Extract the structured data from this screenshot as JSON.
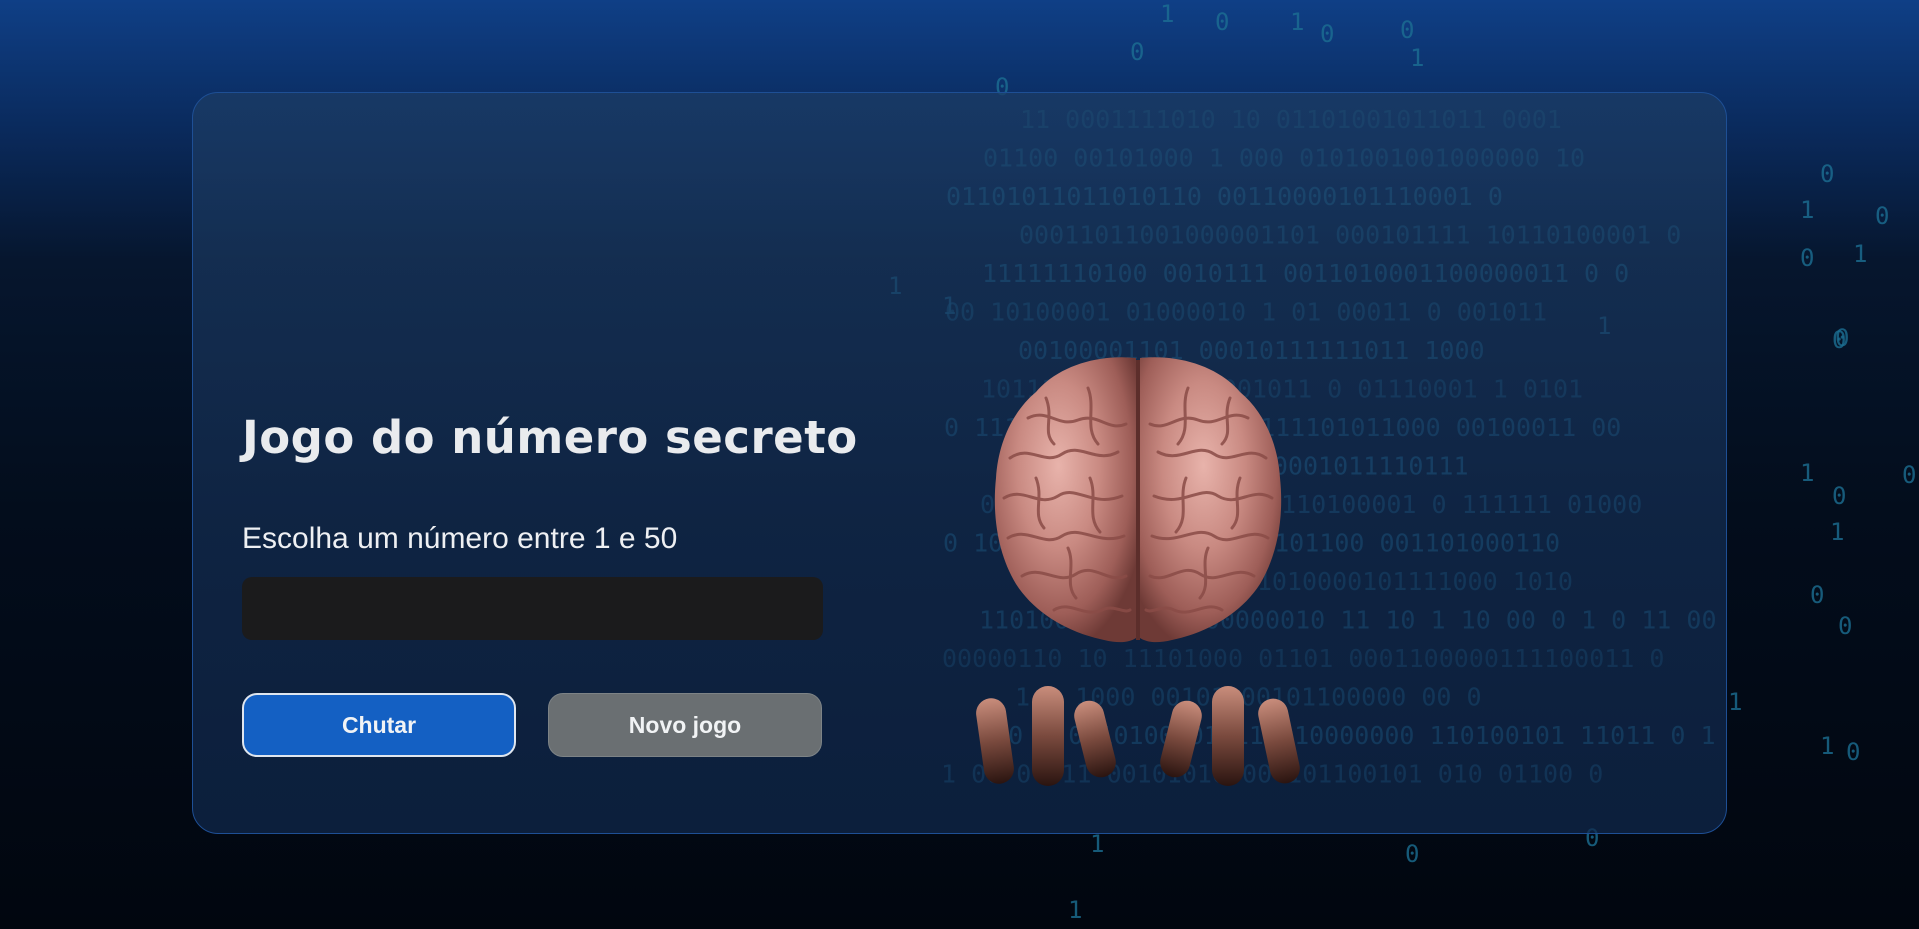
{
  "page": {
    "title": "Jogo do número secreto",
    "prompt": "Escolha um número entre 1 e 50"
  },
  "input": {
    "value": "",
    "placeholder": ""
  },
  "buttons": {
    "guess_label": "Chutar",
    "new_game_label": "Novo jogo"
  },
  "illustration": {
    "icon": "brain-with-hands-illustration"
  },
  "background": {
    "rows": [
      "11 0001111010 10 01101001011011 0001",
      "01100 00101000 1  000 0101001001000000 10",
      "01101011011010110  00110000101110001 0",
      "00011011001000001101 000101111  10110100001 0",
      "11111110100 0010111 0011010001100000011 0 0",
      "00 10100001 01000010  1 01 00011   0 001011",
      "00100001101 00010111111011 1000",
      "1011100011110100001011  0 01110001 1 0101",
      "0 111111 1 0000  0  111111101011000  00100011 00",
      "1 0  1110100  10 100001011110111",
      "010010100110100 1000110100001 0 111111 01000",
      "0 100010 1000111010000101100 001101000110",
      "0 0   1011100101111010000101111000 1010",
      "1101000  0110  1100000010 11 10 1 10 00 0 1 0 11 00",
      "00000110 10   11101000 01101  0001100000111100011 0",
      "1 0  1000  00101100101100000 00  0",
      "000 0   00101000010110010000000 110100101 11011 0 1",
      "1 00 0  011 00101010000 101100101 010 01100 0"
    ],
    "digits": [
      "1",
      "0",
      "1",
      "0",
      "0",
      "0",
      "1",
      "0",
      "0",
      "1",
      "0",
      "1",
      "0",
      "1",
      "1",
      "1",
      "0",
      "0",
      "0",
      "1",
      "0",
      "1",
      "0",
      "0",
      "1",
      "1",
      "0",
      "1",
      "0"
    ]
  }
}
